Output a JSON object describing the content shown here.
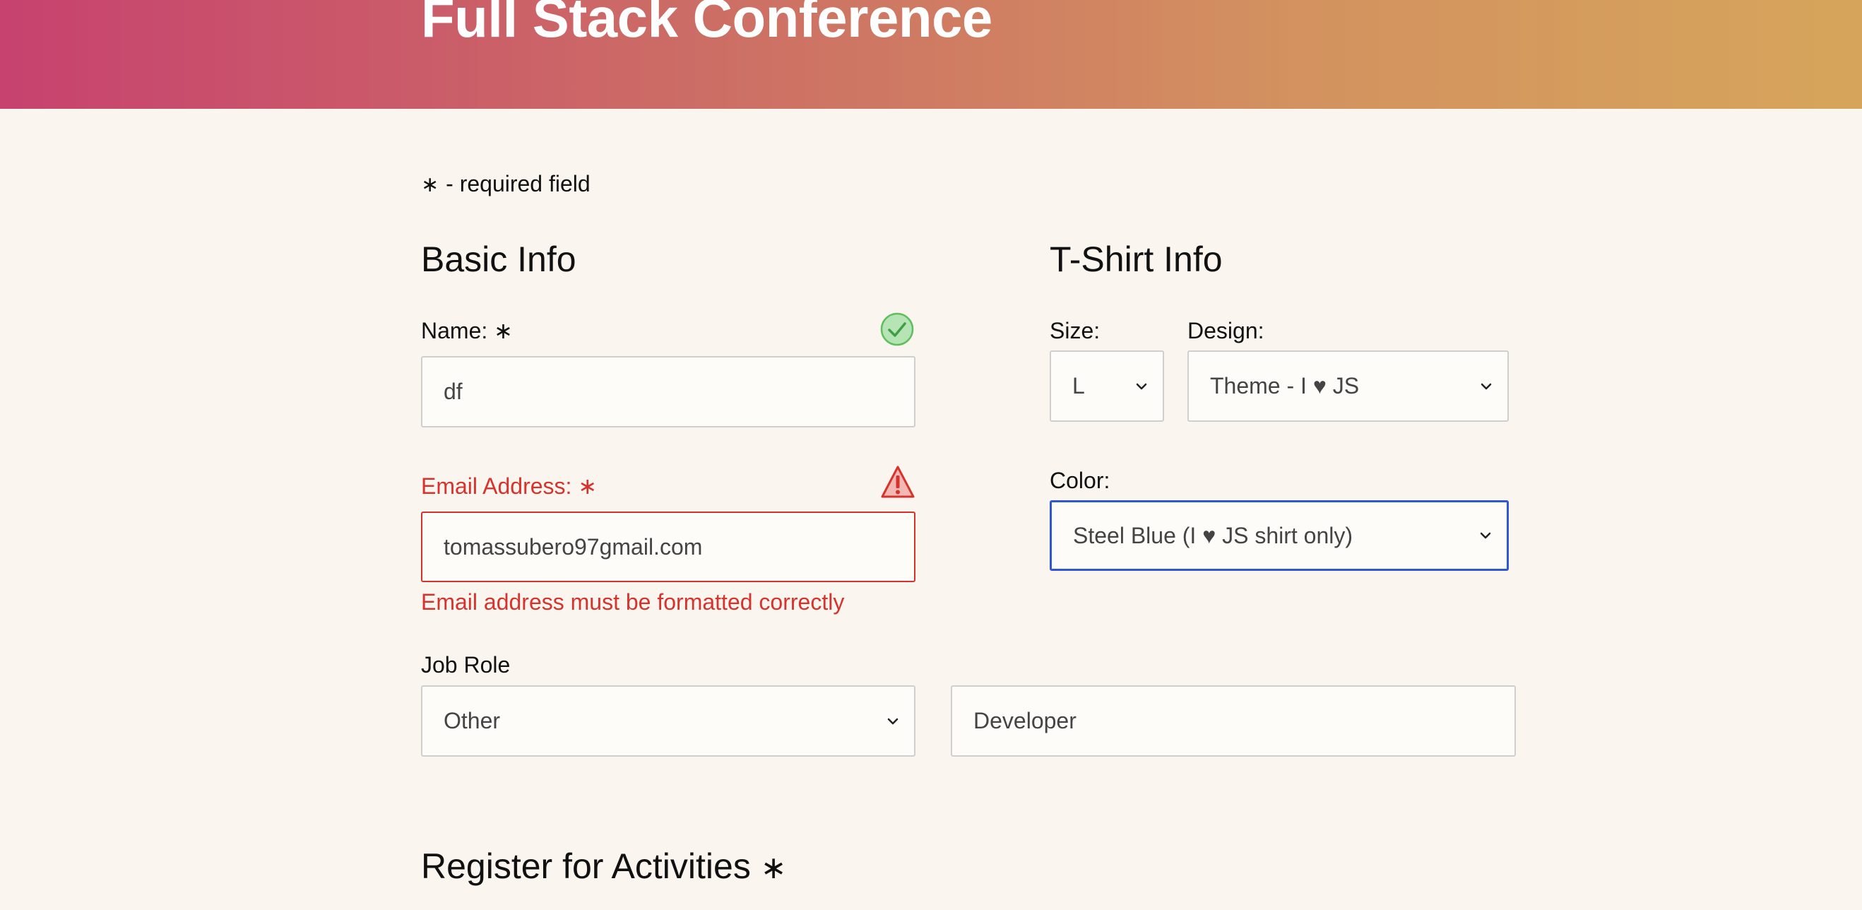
{
  "header": {
    "title": "Full Stack Conference"
  },
  "required_note": {
    "star": "∗",
    "text": "- required field"
  },
  "basic_info": {
    "title": "Basic Info",
    "name": {
      "label": "Name:",
      "required_mark": "∗",
      "value": "df",
      "status_icon": "check-circle-icon"
    },
    "email": {
      "label": "Email Address:",
      "required_mark": "∗",
      "value": "tomassubero97gmail.com",
      "status_icon": "warning-triangle-icon",
      "error": "Email address must be formatted correctly"
    },
    "job_role": {
      "label": "Job Role",
      "selected": "Other",
      "other_value": "Developer"
    }
  },
  "tshirt_info": {
    "title": "T-Shirt Info",
    "size": {
      "label": "Size:",
      "selected": "L"
    },
    "design": {
      "label": "Design:",
      "selected": "Theme - I ♥ JS"
    },
    "color": {
      "label": "Color:",
      "selected": "Steel Blue (I ♥ JS shirt only)"
    }
  },
  "activities": {
    "title": "Register for Activities",
    "required_mark": "∗"
  },
  "colors": {
    "error": "#d7332d",
    "success": "#5fbf5f",
    "focus": "#2f56d3",
    "background": "#faf5ef"
  }
}
